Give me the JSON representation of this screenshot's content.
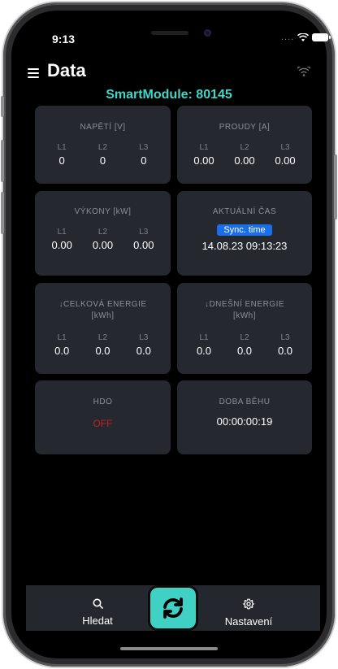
{
  "status": {
    "time": "9:13"
  },
  "header": {
    "title": "Data",
    "module_name": "SmartModule: 80145"
  },
  "cards": {
    "voltage": {
      "title": "NAPĚTÍ [V]",
      "phases": [
        {
          "label": "L1",
          "value": "0"
        },
        {
          "label": "L2",
          "value": "0"
        },
        {
          "label": "L3",
          "value": "0"
        }
      ]
    },
    "current": {
      "title": "PROUDY [A]",
      "phases": [
        {
          "label": "L1",
          "value": "0.00"
        },
        {
          "label": "L2",
          "value": "0.00"
        },
        {
          "label": "L3",
          "value": "0.00"
        }
      ]
    },
    "power": {
      "title": "VÝKONY [kW]",
      "phases": [
        {
          "label": "L1",
          "value": "0.00"
        },
        {
          "label": "L2",
          "value": "0.00"
        },
        {
          "label": "L3",
          "value": "0.00"
        }
      ]
    },
    "time": {
      "title": "AKTUÁLNÍ ČAS",
      "button_label": "Sync. time",
      "value": "14.08.23 09:13:23"
    },
    "total_energy": {
      "title_line1": "↓CELKOVÁ ENERGIE",
      "title_line2": "[kWh]",
      "phases": [
        {
          "label": "L1",
          "value": "0.0"
        },
        {
          "label": "L2",
          "value": "0.0"
        },
        {
          "label": "L3",
          "value": "0.0"
        }
      ]
    },
    "today_energy": {
      "title_line1": "↓DNEŠNÍ ENERGIE",
      "title_line2": "[kWh]",
      "phases": [
        {
          "label": "L1",
          "value": "0.0"
        },
        {
          "label": "L2",
          "value": "0.0"
        },
        {
          "label": "L3",
          "value": "0.0"
        }
      ]
    },
    "hdo": {
      "title": "HDO",
      "value": "OFF",
      "value_color": "#c0221f"
    },
    "runtime": {
      "title": "DOBA BĚHU",
      "value": "00:00:00:19"
    }
  },
  "tabbar": {
    "search_label": "Hledat",
    "settings_label": "Nastavení",
    "search_icon": "search-icon",
    "refresh_icon": "refresh-icon",
    "settings_icon": "gear-icon"
  },
  "colors": {
    "accent": "#3ed1c4",
    "module_text": "#40d6c8",
    "card_bg": "#25282f",
    "sync_button": "#1a6fe8"
  }
}
